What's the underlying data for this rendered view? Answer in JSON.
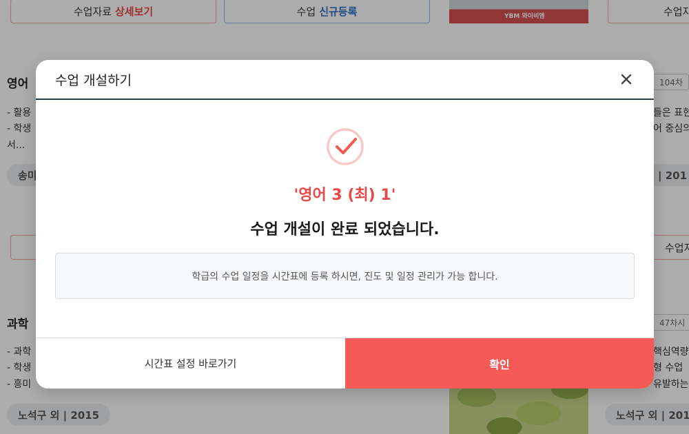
{
  "background": {
    "top_buttons": [
      {
        "prefix": "수업자료",
        "accent": "상세보기"
      },
      {
        "prefix": "수업",
        "accent": "신규등록"
      },
      {
        "prefix": "수업자",
        "accent": ""
      }
    ],
    "mid_buttons": [
      {
        "prefix": "",
        "accent": ""
      },
      {
        "prefix": "수업자",
        "accent": ""
      }
    ],
    "thumb_label": "YBM 와이비엠",
    "card1": {
      "title": "영어",
      "lines": [
        "- 활용",
        "- 학생",
        "서..."
      ],
      "right_lines": [
        "들은 표현",
        "어 중심의"
      ],
      "pill_left": "송미",
      "pill_right": "외 | 201",
      "badge": "104차"
    },
    "card2": {
      "title": "과학",
      "lines": [
        "- 과학",
        "- 학생",
        "- 흥미"
      ],
      "right_lines": [
        "핵심역량",
        "형 수업",
        "유발하는"
      ],
      "pill_left": "노석구 외 | 2015",
      "pill_right": "노석구 외 | 201",
      "badge": "47차시"
    }
  },
  "modal": {
    "title": "수업 개설하기",
    "close_icon": "close-icon",
    "success_icon": "check-circle-icon",
    "course_name": "'영어 3 (최) 1'",
    "message": "수업 개설이 완료 되었습니다.",
    "info": "학급의 수업 일정을 시간표에 등록 하시면, 진도 및 일정 관리가 가능 합니다.",
    "secondary_button": "시간표 설정 바로가기",
    "primary_button": "확인",
    "colors": {
      "accent": "#e84848",
      "primary_button": "#f55a57",
      "header_line": "#2c3e4c"
    }
  }
}
